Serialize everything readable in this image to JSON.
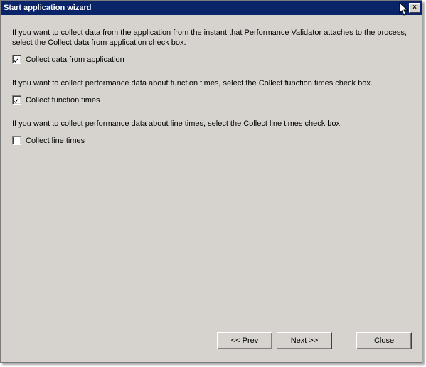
{
  "title": "Start application wizard",
  "sections": {
    "dataApp": {
      "desc": "If you want to collect data from the application from the instant that Performance Validator attaches to the process, select the Collect data from application check box.",
      "label": "Collect data from application",
      "checked": true
    },
    "funcTimes": {
      "desc": "If you want to collect performance data about function times, select the Collect function times check box.",
      "label": "Collect function times",
      "checked": true
    },
    "lineTimes": {
      "desc": "If you want to collect performance data about line times, select the Collect line times check box.",
      "label": "Collect line times",
      "checked": false
    }
  },
  "buttons": {
    "prev": "<< Prev",
    "next": "Next >>",
    "close": "Close"
  },
  "sys": {
    "close": "×"
  }
}
